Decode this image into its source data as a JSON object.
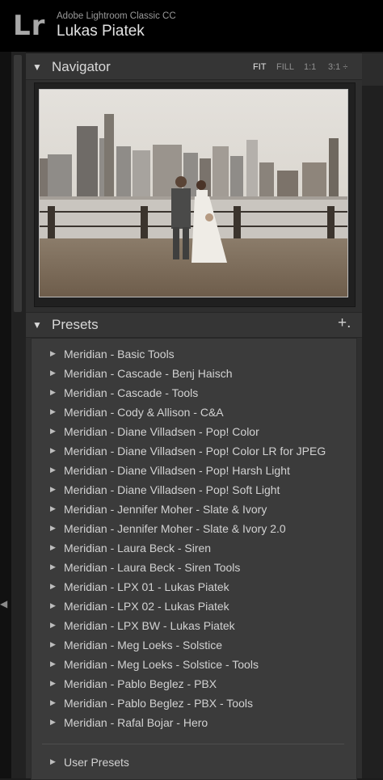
{
  "header": {
    "logo": "Lr",
    "app_name": "Adobe Lightroom Classic CC",
    "user_name": "Lukas Piatek"
  },
  "navigator": {
    "title": "Navigator",
    "zoom_options": [
      "FIT",
      "FILL",
      "1:1",
      "3:1 ÷"
    ],
    "active_zoom": "FIT"
  },
  "presets": {
    "title": "Presets",
    "add_label": "+.",
    "items": [
      "Meridian - Basic Tools",
      "Meridian - Cascade - Benj Haisch",
      "Meridian - Cascade - Tools",
      "Meridian - Cody & Allison - C&A",
      "Meridian - Diane Villadsen - Pop! Color",
      "Meridian - Diane Villadsen - Pop! Color LR for JPEG",
      "Meridian - Diane Villadsen - Pop! Harsh Light",
      "Meridian - Diane Villadsen - Pop! Soft Light",
      "Meridian - Jennifer Moher - Slate & Ivory",
      "Meridian - Jennifer Moher - Slate & Ivory 2.0",
      "Meridian - Laura Beck - Siren",
      "Meridian - Laura Beck - Siren Tools",
      "Meridian - LPX 01 - Lukas Piatek",
      "Meridian - LPX 02 - Lukas Piatek",
      "Meridian - LPX BW - Lukas Piatek",
      "Meridian - Meg Loeks - Solstice",
      "Meridian - Meg Loeks - Solstice - Tools",
      "Meridian - Pablo Beglez - PBX",
      "Meridian - Pablo Beglez - PBX - Tools",
      "Meridian - Rafal Bojar - Hero"
    ],
    "user_presets": "User Presets"
  },
  "icons": {
    "disclosure": "▼",
    "folder_collapsed": "▶",
    "left_panel_toggle": "◀"
  }
}
